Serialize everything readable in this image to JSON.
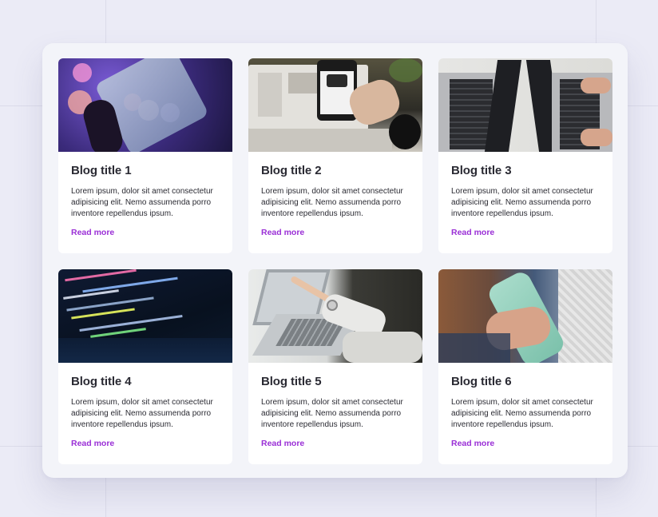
{
  "colors": {
    "page_background": "#ebebf6",
    "panel_background": "#f3f4f9",
    "card_background": "#ffffff",
    "title_color": "#2a2a33",
    "link_color": "#9a2fd6"
  },
  "posts": [
    {
      "title": "Blog title 1",
      "excerpt": "Lorem ipsum, dolor sit amet consectetur adipisicing elit. Nemo assumenda porro inventore repellendus ipsum.",
      "link_label": "Read more",
      "image_subject": "hand holding smartphone with colorful bokeh lights"
    },
    {
      "title": "Blog title 2",
      "excerpt": "Lorem ipsum, dolor sit amet consectetur adipisicing elit. Nemo assumenda porro inventore repellendus ipsum.",
      "link_label": "Read more",
      "image_subject": "hand holding phone in front of laptop"
    },
    {
      "title": "Blog title 3",
      "excerpt": "Lorem ipsum, dolor sit amet consectetur adipisicing elit. Nemo assumenda porro inventore repellendus ipsum.",
      "link_label": "Read more",
      "image_subject": "two laptops back to back, person typing"
    },
    {
      "title": "Blog title 4",
      "excerpt": "Lorem ipsum, dolor sit amet consectetur adipisicing elit. Nemo assumenda porro inventore repellendus ipsum.",
      "link_label": "Read more",
      "image_subject": "code on a dark laptop screen"
    },
    {
      "title": "Blog title 5",
      "excerpt": "Lorem ipsum, dolor sit amet consectetur adipisicing elit. Nemo assumenda porro inventore repellendus ipsum.",
      "link_label": "Read more",
      "image_subject": "person pointing at laptop screen"
    },
    {
      "title": "Blog title 6",
      "excerpt": "Lorem ipsum, dolor sit amet consectetur adipisicing elit. Nemo assumenda porro inventore repellendus ipsum.",
      "link_label": "Read more",
      "image_subject": "hand holding mint-colored smartphone"
    }
  ]
}
